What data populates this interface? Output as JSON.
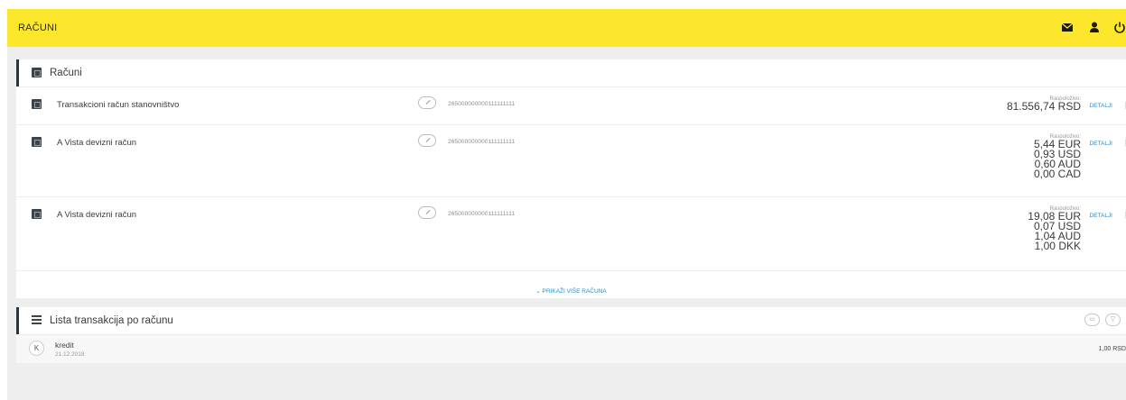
{
  "header": {
    "title": "RAČUNI",
    "icons": [
      "mail-icon",
      "user-icon",
      "power-icon"
    ]
  },
  "accounts_section": {
    "title": "Računi",
    "available_label": "Raspoloživo:",
    "details_label": "DETALJI",
    "accounts": [
      {
        "name": "Transakcioni račun stanovništvo",
        "number": "265000000000111111111",
        "balances": [
          "81.556,74 RSD"
        ]
      },
      {
        "name": "A Vista devizni račun",
        "number": "265000000000111111111",
        "balances": [
          "5,44 EUR",
          "0,93 USD",
          "0,60 AUD",
          "0,00 CAD"
        ]
      },
      {
        "name": "A Vista devizni račun",
        "number": "265000000000111111111",
        "balances": [
          "19,08 EUR",
          "0,07 USD",
          "1,04 AUD",
          "1,00 DKK"
        ]
      }
    ],
    "show_more": "⌄ PRIKAŽI VIŠE RAČUNA"
  },
  "transactions_section": {
    "title": "Lista transakcija po računu",
    "transactions": [
      {
        "badge": "K",
        "type": "kredit",
        "date": "21.12.2018",
        "amount": "1,00 RSD"
      }
    ]
  },
  "colors": {
    "header_bg": "#fde72d",
    "link": "#2f8ec1",
    "page_bg": "#eeeeee"
  }
}
